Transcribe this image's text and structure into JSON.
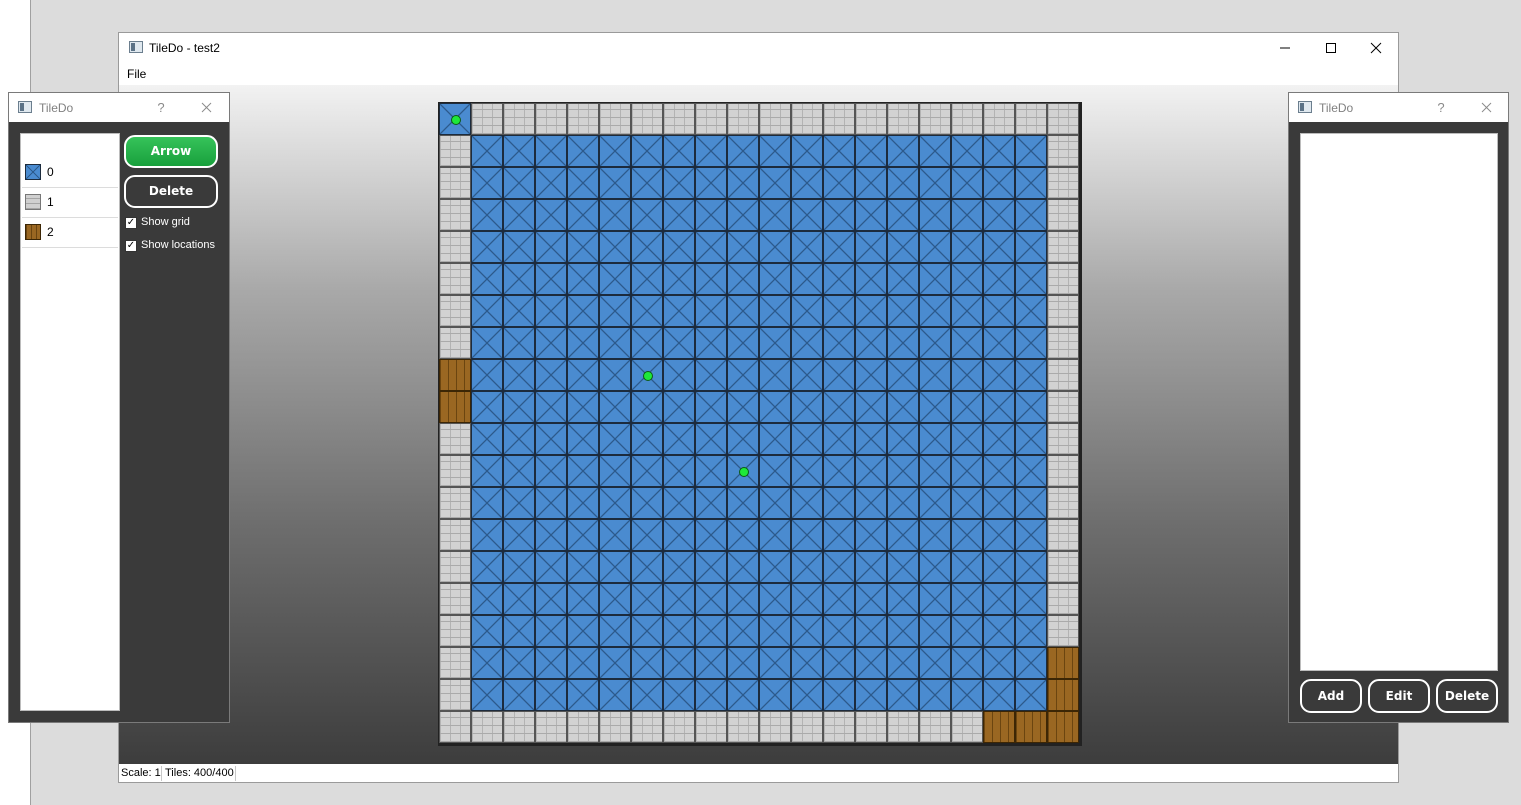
{
  "main_window": {
    "title": "TileDo - test2",
    "menu": [
      "File"
    ],
    "status": {
      "scale": "Scale: 1",
      "tiles": "Tiles: 400/400"
    }
  },
  "tile_panel": {
    "title": "TileDo",
    "help": "?",
    "tiles": [
      {
        "label": "0",
        "type": "water"
      },
      {
        "label": "1",
        "type": "stone"
      },
      {
        "label": "2",
        "type": "wood"
      }
    ],
    "arrow_label": "Arrow",
    "delete_label": "Delete",
    "show_grid_label": "Show grid",
    "show_grid_checked": true,
    "show_locations_label": "Show locations",
    "show_locations_checked": true
  },
  "locations_panel": {
    "title": "TileDo",
    "help": "?",
    "add_label": "Add",
    "edit_label": "Edit",
    "delete_label": "Delete"
  },
  "map": {
    "cols": 20,
    "rows": 20,
    "legend": {
      "0": "water",
      "1": "stone",
      "2": "wood"
    },
    "grid": [
      "01111111111111111111",
      "10000000000000000001",
      "10000000000000000001",
      "10000000000000000001",
      "10000000000000000001",
      "10000000000000000001",
      "10000000000000000001",
      "10000000000000000001",
      "20000000000000000001",
      "20000000000000000001",
      "10000000000000000001",
      "10000000000000000001",
      "10000000000000000001",
      "10000000000000000001",
      "10000000000000000001",
      "10000000000000000001",
      "10000000000000000001",
      "10000000000000000002",
      "10000000000000000002",
      "11111111111111111222"
    ],
    "locations": [
      {
        "col": 0,
        "row": 0
      },
      {
        "col": 6,
        "row": 8
      },
      {
        "col": 9,
        "row": 11
      }
    ]
  },
  "colors": {
    "water": "#4a8bd0",
    "stone": "#d2d2d2",
    "wood": "#9a6722",
    "location_marker": "#1ee83a",
    "arrow_button": "#22aa44",
    "panel_bg": "#3a3a3a"
  },
  "icons": [
    "app-icon",
    "minimize-icon",
    "maximize-icon",
    "close-icon",
    "help-icon",
    "checkmark-icon"
  ]
}
